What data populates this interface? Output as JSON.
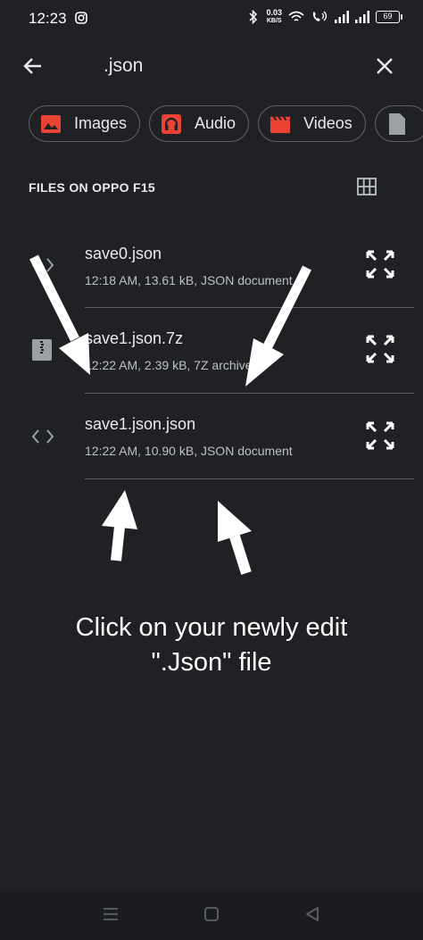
{
  "status_bar": {
    "time": "12:23",
    "net_speed_value": "0.03",
    "net_speed_unit": "KB/S",
    "battery": "69"
  },
  "search": {
    "query": ".json"
  },
  "chips": [
    {
      "label": "Images",
      "icon": "image-icon"
    },
    {
      "label": "Audio",
      "icon": "headphones-icon"
    },
    {
      "label": "Videos",
      "icon": "clapperboard-icon"
    }
  ],
  "section": {
    "title": "FILES ON OPPO F15"
  },
  "files": [
    {
      "name": "save0.json",
      "meta": "12:18 AM, 13.61 kB, JSON document",
      "icon": "code-icon"
    },
    {
      "name": "save1.json.7z",
      "meta": "12:22 AM, 2.39 kB, 7Z archive",
      "icon": "archive-icon"
    },
    {
      "name": "save1.json.json",
      "meta": "12:22 AM, 10.90 kB, JSON document",
      "icon": "code-icon"
    }
  ],
  "instruction": {
    "line1": "Click on your newly edit",
    "line2": "\".Json\" file"
  },
  "colors": {
    "background": "#202124",
    "chip_icon_red": "#ea4335",
    "text": "#e8eaed",
    "divider": "#5f6368"
  }
}
